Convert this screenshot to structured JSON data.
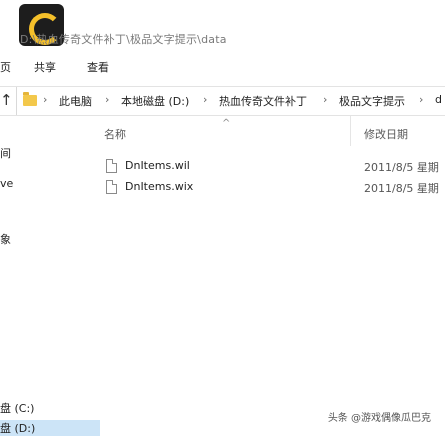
{
  "window": {
    "path": "D:\\热血传奇文件补丁\\极品文字提示\\data"
  },
  "ribbon": {
    "tab_file": "页",
    "tab_share": "共享",
    "tab_view": "查看"
  },
  "address": {
    "up": "↑",
    "crumbs": [
      "此电脑",
      "本地磁盘 (D:)",
      "热血传奇文件补丁",
      "极品文字提示",
      "d"
    ],
    "separator": "›"
  },
  "nav": {
    "items": [
      "间",
      "ve",
      "象"
    ],
    "drive_c": "盘 (C:)",
    "drive_d": "盘 (D:)"
  },
  "columns": {
    "name": "名称",
    "date": "修改日期",
    "sort": "^"
  },
  "files": [
    {
      "name": "DnItems.wil",
      "date": "2011/8/5 星期"
    },
    {
      "name": "DnItems.wix",
      "date": "2011/8/5 星期"
    }
  ],
  "watermark": "头条 @游戏偶像瓜巴克",
  "colors": {
    "folder": "#f3c84b",
    "selection": "#cce4f7",
    "app_icon_bg": "#1d1d1d",
    "app_icon_ring": "#f5c02a"
  }
}
